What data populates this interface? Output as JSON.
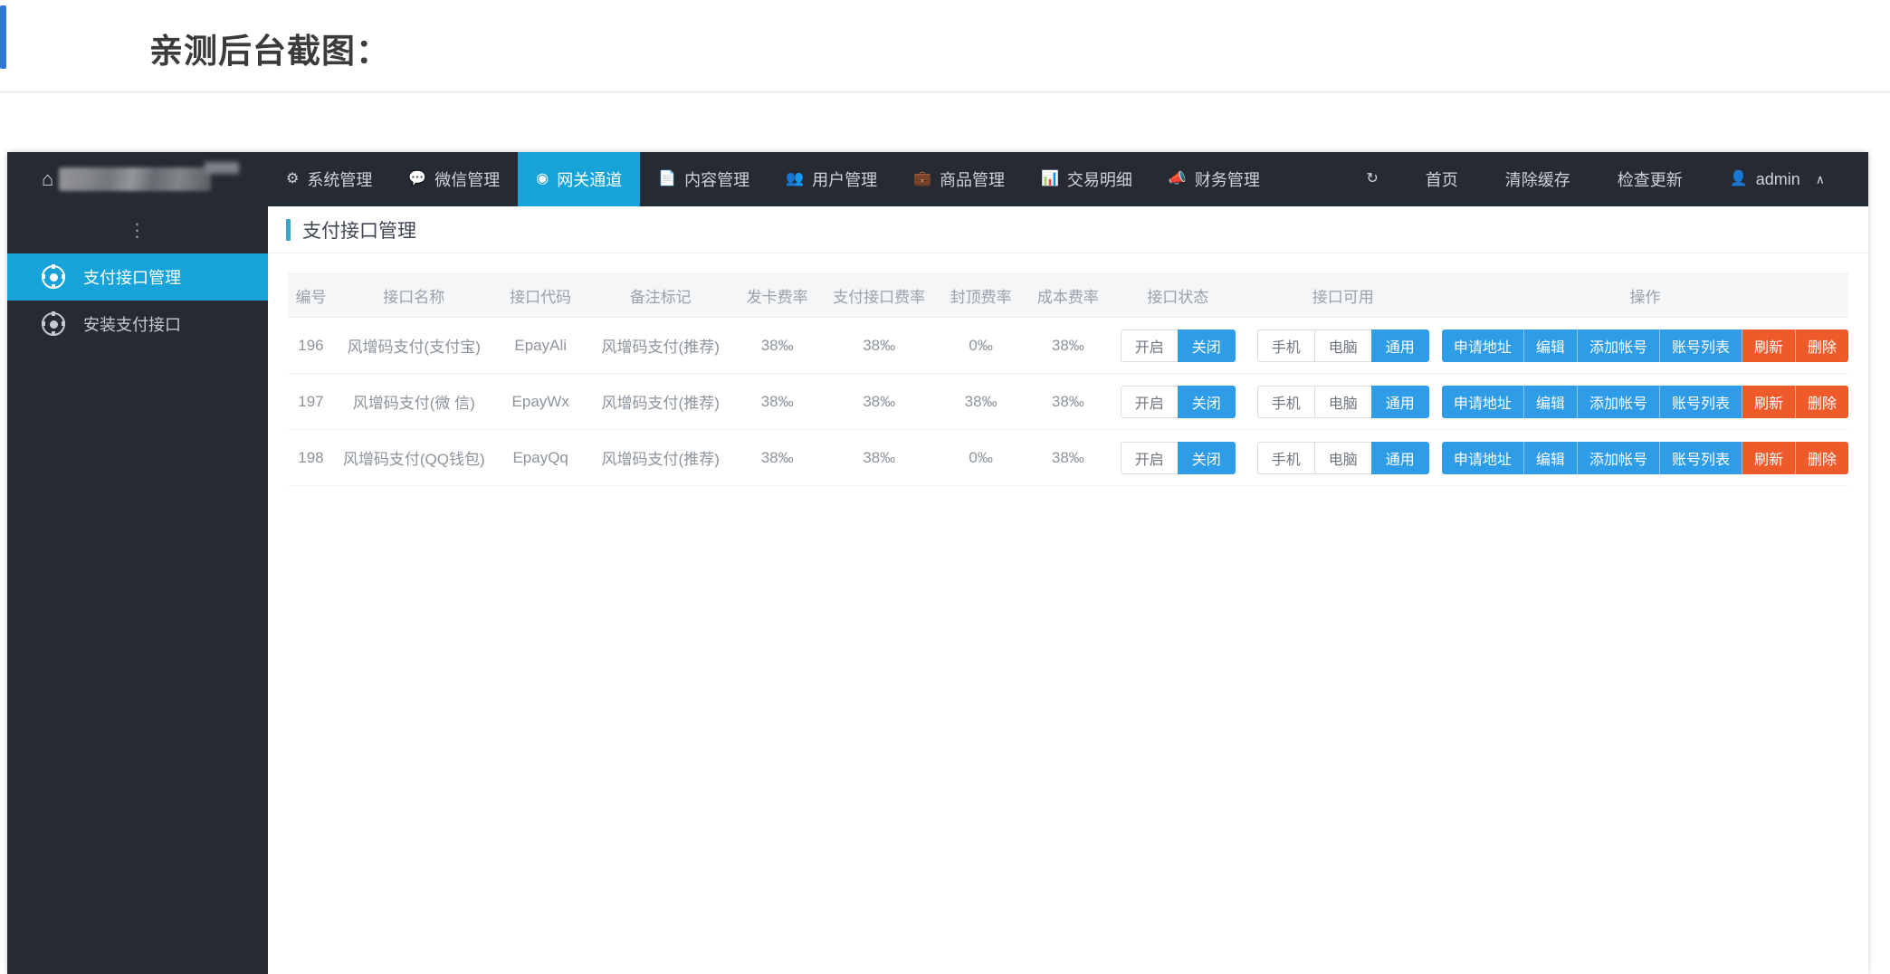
{
  "article": {
    "title": "亲测后台截图："
  },
  "topnav": {
    "brand_home_icon": "home-icon",
    "items": [
      {
        "label": "系统管理",
        "icon": "gear-icon",
        "glyph": "⚙",
        "active": false
      },
      {
        "label": "微信管理",
        "icon": "comment-icon",
        "glyph": "💬",
        "active": false
      },
      {
        "label": "网关通道",
        "icon": "compass-icon",
        "glyph": "◉",
        "active": true
      },
      {
        "label": "内容管理",
        "icon": "file-icon",
        "glyph": "📄",
        "active": false
      },
      {
        "label": "用户管理",
        "icon": "users-icon",
        "glyph": "👥",
        "active": false
      },
      {
        "label": "商品管理",
        "icon": "briefcase-icon",
        "glyph": "💼",
        "active": false
      },
      {
        "label": "交易明细",
        "icon": "chart-bar-icon",
        "glyph": "📊",
        "active": false
      },
      {
        "label": "财务管理",
        "icon": "megaphone-icon",
        "glyph": "📣",
        "active": false
      }
    ],
    "right": {
      "refresh_icon": "refresh-icon",
      "refresh_glyph": "↻",
      "home_label": "首页",
      "clear_cache_label": "清除缓存",
      "check_update_label": "检查更新",
      "user_icon": "user-icon",
      "user_glyph": "👤",
      "user_name": "admin",
      "chevron": "∧"
    }
  },
  "sidebar": {
    "dots": "⋮",
    "items": [
      {
        "label": "支付接口管理",
        "icon": "cog-circle-icon",
        "active": true
      },
      {
        "label": "安装支付接口",
        "icon": "cog-circle-icon",
        "active": false
      }
    ]
  },
  "page": {
    "title": "支付接口管理"
  },
  "table": {
    "headers": [
      "编号",
      "接口名称",
      "接口代码",
      "备注标记",
      "发卡费率",
      "支付接口费率",
      "封顶费率",
      "成本费率",
      "接口状态",
      "接口可用",
      "操作"
    ],
    "status_options": [
      "开启",
      "关闭"
    ],
    "avail_options": [
      "手机",
      "电脑",
      "通用"
    ],
    "action_labels": [
      "申请地址",
      "编辑",
      "添加帐号",
      "账号列表",
      "刷新",
      "删除"
    ],
    "rows": [
      {
        "id": "196",
        "name": "风增码支付(支付宝)",
        "code": "EpayAli",
        "remark": "风增码支付(推荐)",
        "card_rate": "38‰",
        "pay_rate": "38‰",
        "cap_rate": "0‰",
        "cost_rate": "38‰",
        "status_active": "关闭",
        "avail_active": "通用"
      },
      {
        "id": "197",
        "name": "风增码支付(微 信)",
        "code": "EpayWx",
        "remark": "风增码支付(推荐)",
        "card_rate": "38‰",
        "pay_rate": "38‰",
        "cap_rate": "38‰",
        "cost_rate": "38‰",
        "status_active": "关闭",
        "avail_active": "通用"
      },
      {
        "id": "198",
        "name": "风增码支付(QQ钱包)",
        "code": "EpayQq",
        "remark": "风增码支付(推荐)",
        "card_rate": "38‰",
        "pay_rate": "38‰",
        "cap_rate": "0‰",
        "cost_rate": "38‰",
        "status_active": "关闭",
        "avail_active": "通用"
      }
    ]
  },
  "colors": {
    "nav_bg": "#262b33",
    "accent_blue": "#17a3da",
    "button_blue": "#2f9ce8",
    "danger_orange": "#ef5a2a",
    "title_accent": "#2f77d8"
  }
}
